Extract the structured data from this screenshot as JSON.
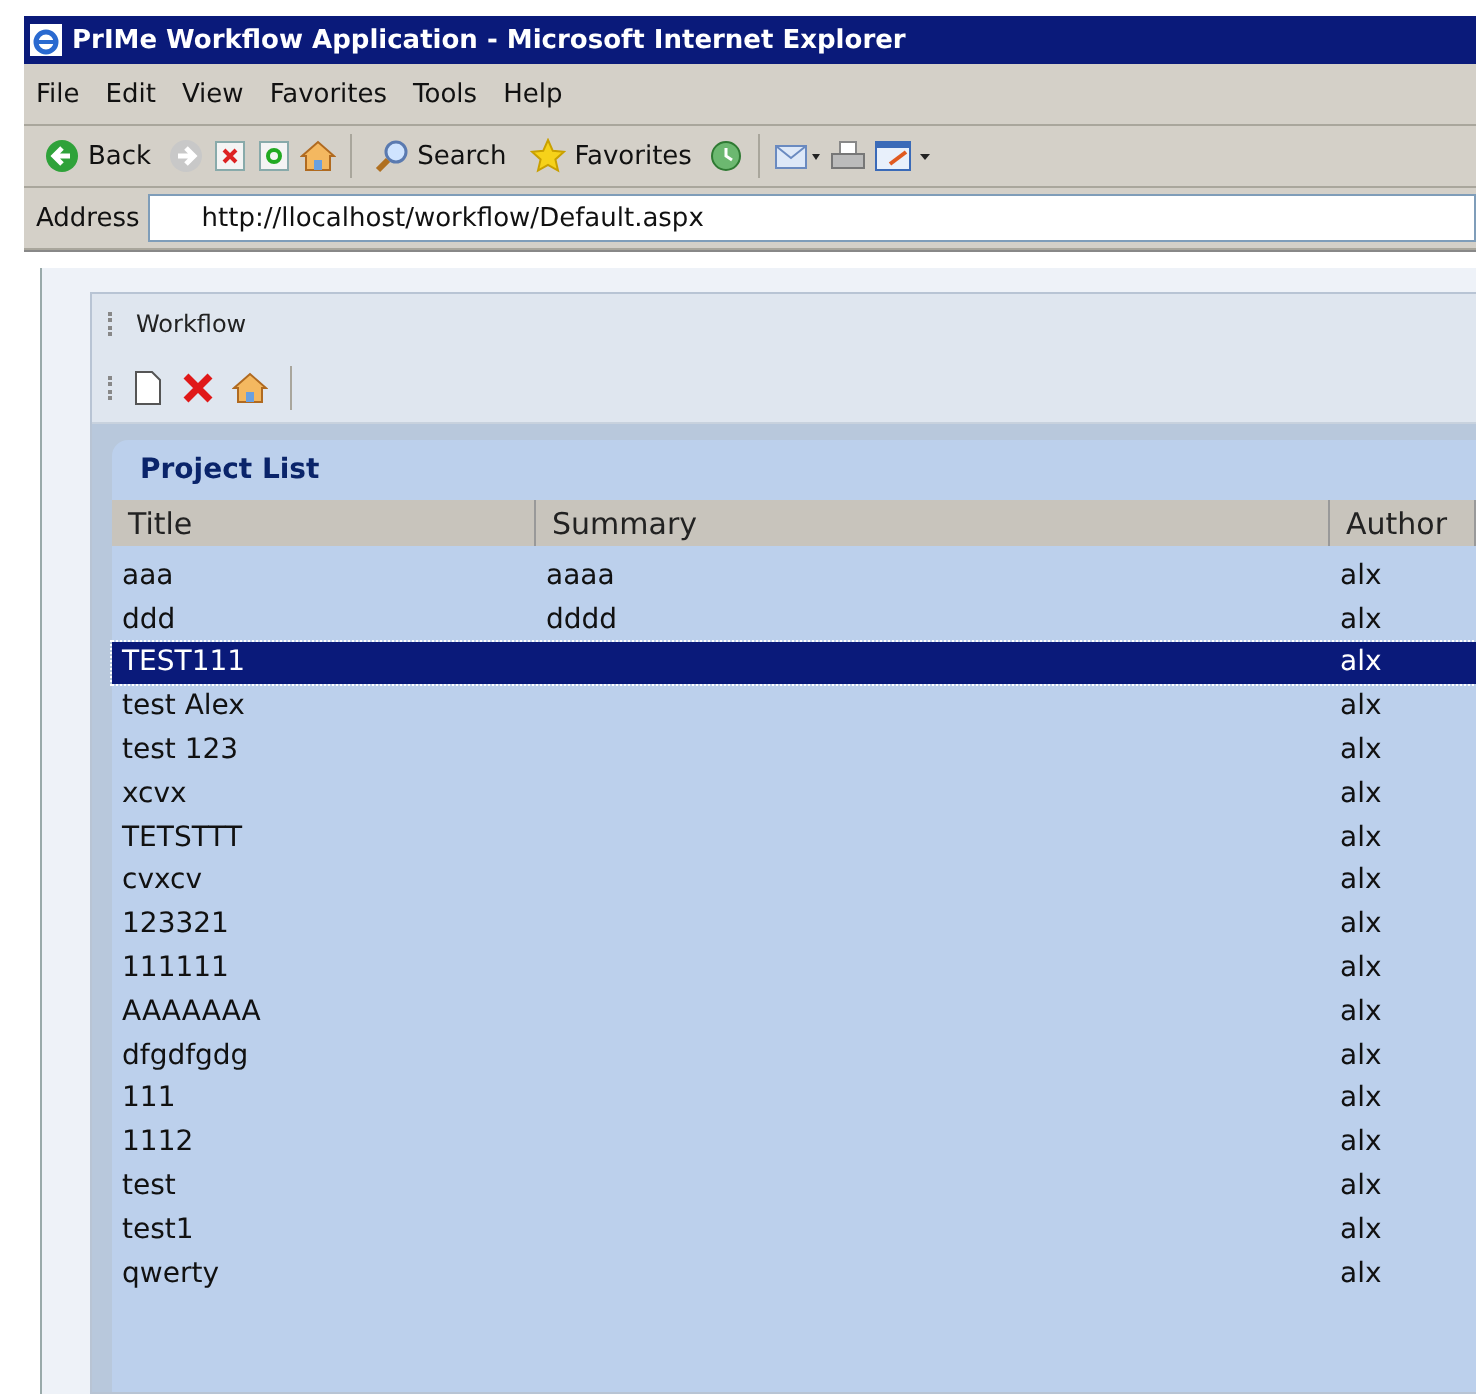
{
  "window": {
    "title": "PrIMe Workflow Application - Microsoft Internet Explorer"
  },
  "menu": [
    "File",
    "Edit",
    "View",
    "Favorites",
    "Tools",
    "Help"
  ],
  "toolbar": [
    {
      "kind": "back",
      "label": "Back"
    },
    {
      "kind": "forward"
    },
    {
      "kind": "stop"
    },
    {
      "kind": "refresh"
    },
    {
      "kind": "home"
    },
    {
      "kind": "search",
      "label": "Search"
    },
    {
      "kind": "favorites",
      "label": "Favorites"
    },
    {
      "kind": "history"
    },
    {
      "kind": "mail"
    },
    {
      "kind": "print"
    },
    {
      "kind": "edit"
    }
  ],
  "address": {
    "label": "Address",
    "value": "http://llocalhost/workflow/Default.aspx"
  },
  "panel": {
    "title": "Workflow",
    "tools": [
      {
        "kind": "new"
      },
      {
        "kind": "delete"
      },
      {
        "kind": "home"
      }
    ]
  },
  "list": {
    "title": "Project List",
    "columns": [
      "Title",
      "Summary",
      "Author"
    ],
    "rows": [
      {
        "title": "aaa",
        "summary": "aaaa",
        "author": "alx",
        "selected": false
      },
      {
        "title": "ddd",
        "summary": "dddd",
        "author": "alx",
        "selected": false
      },
      {
        "title": "TEST111",
        "summary": "",
        "author": "alx",
        "selected": true
      },
      {
        "title": "test Alex",
        "author": "alx",
        "selected": false
      },
      {
        "title": "test 123",
        "author": "alx",
        "selected": false
      },
      {
        "title": "xcvx",
        "author": "alx",
        "selected": false
      },
      {
        "title": "TETSTTT",
        "author": "alx",
        "selected": false
      },
      {
        "title": "cvxcv",
        "author": "alx",
        "selected": false
      },
      {
        "title": "123321",
        "author": "alx",
        "selected": false
      },
      {
        "title": "111111",
        "author": "alx",
        "selected": false
      },
      {
        "title": "AAAAAAA",
        "author": "alx",
        "selected": false
      },
      {
        "title": "dfgdfgdg",
        "author": "alx",
        "selected": false
      },
      {
        "title": "111",
        "author": "alx",
        "selected": false
      },
      {
        "title": "1112",
        "author": "alx",
        "selected": false
      },
      {
        "title": "test",
        "author": "alx",
        "selected": false
      },
      {
        "title": "test1",
        "author": "alx",
        "selected": false
      },
      {
        "title": "qwerty",
        "author": "alx",
        "selected": false
      }
    ]
  }
}
